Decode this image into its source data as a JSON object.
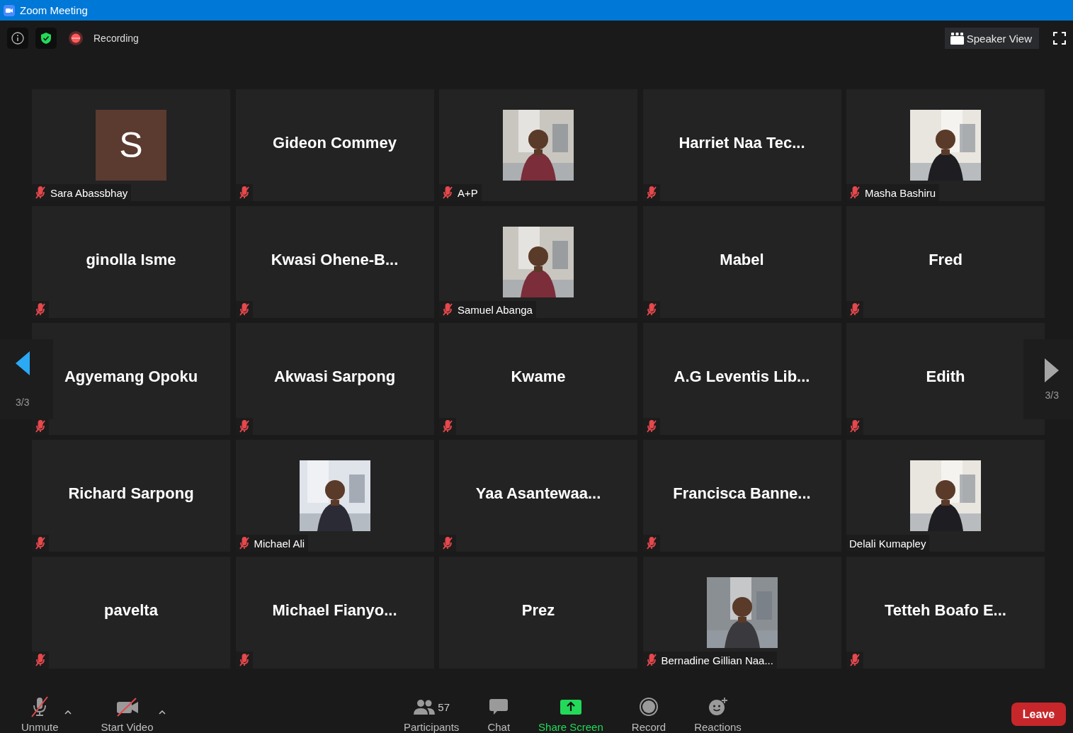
{
  "window": {
    "title": "Zoom Meeting"
  },
  "top_bar": {
    "recording": "Recording",
    "view_button": "Speaker View"
  },
  "pager": [
    {
      "kind": "previous",
      "label": "3/3",
      "highlighted": true
    },
    {
      "kind": "next",
      "label": "3/3",
      "highlighted": false
    }
  ],
  "tiles": [
    {
      "kind": "initial",
      "initial": "S",
      "name": "Sara Abassbhay",
      "muted": true
    },
    {
      "kind": "name",
      "name": "Gideon Commey",
      "muted": true
    },
    {
      "kind": "picture",
      "name": "A+P",
      "muted": true
    },
    {
      "kind": "name",
      "name": "Harriet Naa Tec...",
      "muted": true
    },
    {
      "kind": "picture",
      "name": "Masha Bashiru",
      "muted": true
    },
    {
      "kind": "name",
      "name": "ginolla Isme",
      "muted": true
    },
    {
      "kind": "name",
      "name": "Kwasi Ohene-B...",
      "muted": true
    },
    {
      "kind": "picture",
      "name": "Samuel Abanga",
      "muted": true
    },
    {
      "kind": "name",
      "name": "Mabel",
      "muted": true
    },
    {
      "kind": "name",
      "name": "Fred",
      "muted": true
    },
    {
      "kind": "name",
      "name": "Agyemang Opoku",
      "muted": true
    },
    {
      "kind": "name",
      "name": "Akwasi Sarpong",
      "muted": true
    },
    {
      "kind": "name",
      "name": "Kwame",
      "muted": true
    },
    {
      "kind": "name",
      "name": "A.G Leventis Lib...",
      "muted": true
    },
    {
      "kind": "name",
      "name": "Edith",
      "muted": true
    },
    {
      "kind": "name",
      "name": "Richard Sarpong",
      "muted": true
    },
    {
      "kind": "picture",
      "name": "Michael Ali",
      "muted": true
    },
    {
      "kind": "name",
      "name": "Yaa Asantewaa...",
      "muted": true
    },
    {
      "kind": "name",
      "name": "Francisca Banne...",
      "muted": true
    },
    {
      "kind": "picture",
      "name": "Delali Kumapley",
      "muted": false
    },
    {
      "kind": "name",
      "name": "pavelta",
      "muted": true
    },
    {
      "kind": "name",
      "name": "Michael Fianyo...",
      "muted": true
    },
    {
      "kind": "name",
      "name": "Prez",
      "muted": false
    },
    {
      "kind": "picture",
      "name": "Bernadine Gillian Naa...",
      "muted": true
    },
    {
      "kind": "name",
      "name": "Tetteh Boafo E...",
      "muted": true
    }
  ],
  "toolbar": [
    {
      "kind": "mic",
      "label": "Unmute"
    },
    {
      "kind": "video",
      "label": "Start Video"
    },
    {
      "kind": "participants",
      "label": "Participants",
      "count": "57"
    },
    {
      "kind": "chat",
      "label": "Chat"
    },
    {
      "kind": "share",
      "label": "Share Screen"
    },
    {
      "kind": "record",
      "label": "Record"
    },
    {
      "kind": "reactions",
      "label": "Reactions"
    }
  ],
  "leave_button": "Leave"
}
